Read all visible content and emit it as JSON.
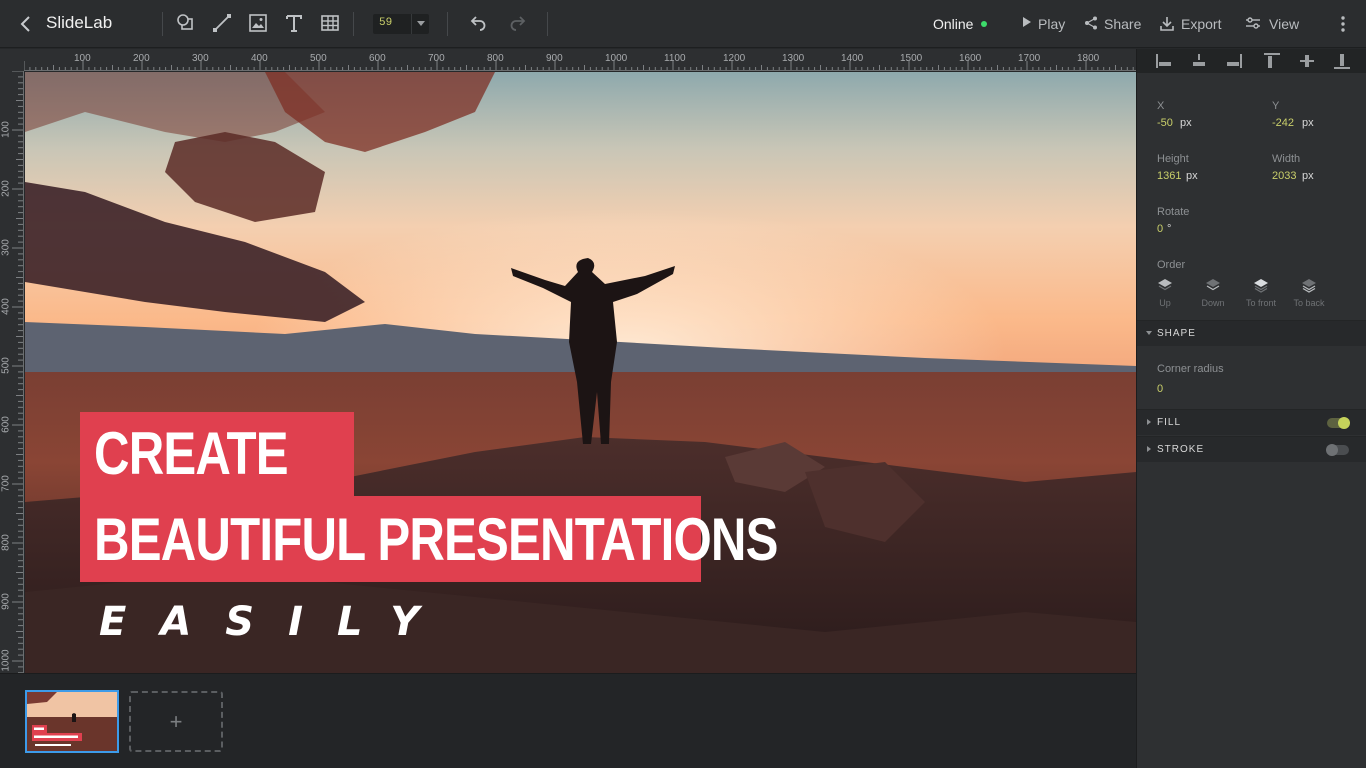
{
  "app": {
    "title": "SlideLab"
  },
  "toolbar": {
    "font_size": "59",
    "status": "Online",
    "status_color": "#3ddc6b",
    "tools": [
      "shape-icon",
      "line-icon",
      "image-icon",
      "text-icon",
      "table-icon"
    ],
    "play_label": "Play",
    "share_label": "Share",
    "export_label": "Export",
    "view_label": "View"
  },
  "ruler": {
    "top_labels": [
      "100",
      "200",
      "300",
      "400",
      "500",
      "600",
      "700",
      "800",
      "900",
      "1000",
      "1100",
      "1200",
      "1300",
      "1400",
      "1500",
      "1600",
      "1700",
      "1800"
    ],
    "left_labels": [
      "100",
      "200",
      "300",
      "400",
      "500",
      "600",
      "700",
      "800",
      "900",
      "1000"
    ]
  },
  "slide": {
    "title_line1": "CREATE",
    "title_line2": "BEAUTIFUL PRESENTATIONS",
    "subtitle": "EASILY",
    "accent_color": "#e0404f"
  },
  "thumbnails": {
    "add_label": "+"
  },
  "panel": {
    "x": {
      "label": "X",
      "value": "-50",
      "unit": "px"
    },
    "y": {
      "label": "Y",
      "value": "-242",
      "unit": "px"
    },
    "height": {
      "label": "Height",
      "value": "1361",
      "unit": "px"
    },
    "width": {
      "label": "Width",
      "value": "2033",
      "unit": "px"
    },
    "rotate": {
      "label": "Rotate",
      "value": "0",
      "unit": "°"
    },
    "order": {
      "label": "Order",
      "buttons": [
        "Up",
        "Down",
        "To front",
        "To back"
      ]
    },
    "shape": {
      "title": "SHAPE",
      "corner_radius_label": "Corner radius",
      "corner_radius_value": "0"
    },
    "fill": {
      "title": "FILL",
      "enabled": true
    },
    "stroke": {
      "title": "STROKE",
      "enabled": false
    }
  }
}
